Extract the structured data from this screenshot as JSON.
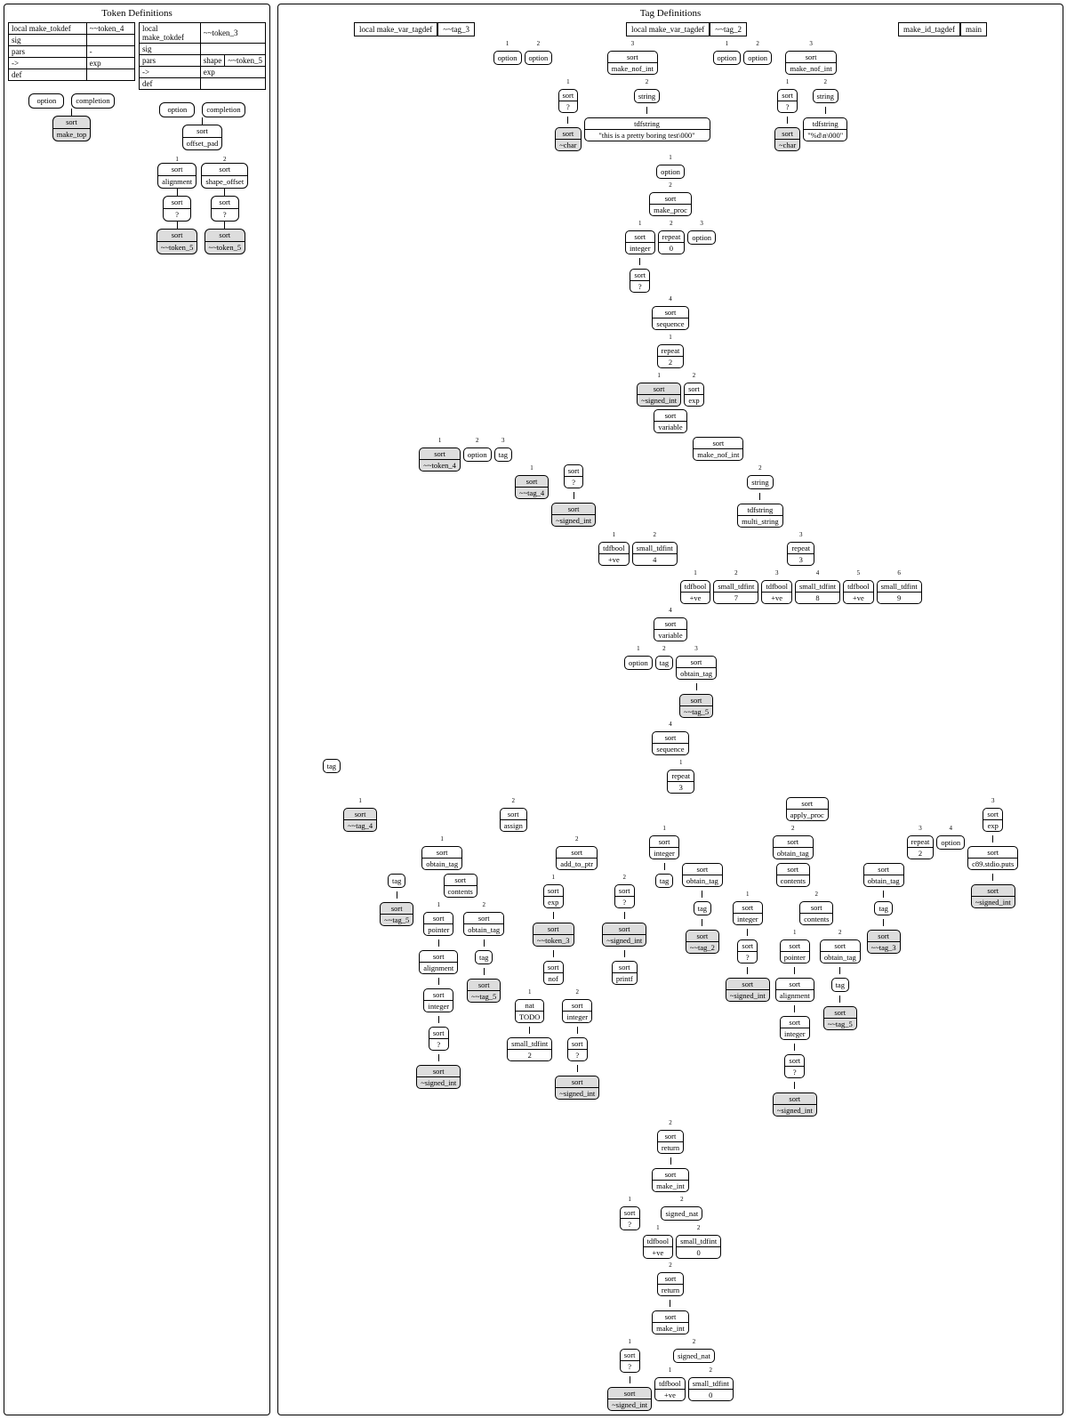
{
  "token_panel": {
    "title": "Token Definitions",
    "tables": [
      {
        "rows": [
          [
            "local make_tokdef",
            "~~token_4"
          ],
          [
            "sig",
            ""
          ],
          [
            "pars",
            "-"
          ],
          [
            "->",
            "exp"
          ],
          [
            "def",
            ""
          ]
        ]
      },
      {
        "rows": [
          [
            "local make_tokdef",
            "",
            "~~token_3"
          ],
          [
            "sig",
            "",
            ""
          ],
          [
            "pars",
            "shape",
            "~~token_5"
          ],
          [
            "->",
            "",
            "exp"
          ],
          [
            "def",
            "",
            ""
          ]
        ]
      }
    ],
    "tree1": {
      "option": "option",
      "completion": "completion",
      "sort": "sort",
      "make_top": "make_top"
    },
    "tree2": {
      "option": "option",
      "completion": "completion",
      "sort": "sort",
      "offset_pad": "offset_pad",
      "alignment": "alignment",
      "shape_offset": "shape_offset",
      "q": "?",
      "token5": "~~token_5"
    }
  },
  "tag_panel": {
    "title": "Tag Definitions",
    "headers": [
      [
        "local make_var_tagdef",
        "~~tag_3"
      ],
      [
        "local make_var_tagdef",
        "~~tag_2"
      ],
      [
        "make_id_tagdef",
        "main"
      ]
    ],
    "lbl": {
      "option": "option",
      "sort": "sort",
      "make_nof_int": "make_nof_int",
      "string": "string",
      "q": "?",
      "char": "~char",
      "tdfstring": "tdfstring",
      "str1": "\"this is a pretty boring test\\000\"",
      "str2": "\"%d\\n\\000\"",
      "make_proc": "make_proc",
      "integer": "integer",
      "repeat": "repeat",
      "sequence": "sequence",
      "return": "return",
      "make_int": "make_int",
      "signed_nat": "signed_nat",
      "tdfbool": "tdfbool",
      "pve": "+ve",
      "small_tdfint": "small_tdfint",
      "signed_int": "~signed_int",
      "exp": "exp",
      "variable": "variable",
      "token4": "~~token_4",
      "tag": "tag",
      "obtain_tag": "obtain_tag",
      "tag4": "~~tag_4",
      "tag5": "~~tag_5",
      "tag3": "~~tag_3",
      "tag2": "~~tag_2",
      "multi_string": "multi_string",
      "assign": "assign",
      "apply_proc": "apply_proc",
      "contents": "contents",
      "pointer": "pointer",
      "alignment": "alignment",
      "add_to_ptr": "add_to_ptr",
      "token3": "~~token_3",
      "printf": "printf",
      "nof": "nof",
      "nat": "nat",
      "TODO": "TODO",
      "c89puts": "c89.stdio.puts",
      "n0": "0",
      "n1": "1",
      "n2": "2",
      "n3": "3",
      "n4": "4",
      "n5": "5",
      "n6": "6",
      "n7": "7",
      "n8": "8",
      "n9": "9"
    }
  }
}
